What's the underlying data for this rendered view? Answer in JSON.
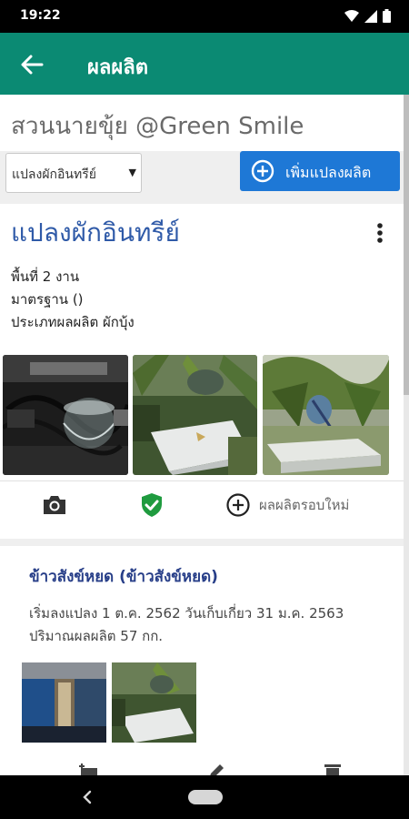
{
  "status_bar": {
    "time": "19:22",
    "icons": [
      "wifi-icon",
      "signal-icon",
      "battery-icon"
    ]
  },
  "app_bar": {
    "title": "ผลผลิต",
    "back_icon": "arrow-left-icon",
    "color": "#0b8a73"
  },
  "farm": {
    "name": "สวนนายขุ้ย @Green Smile"
  },
  "plot_selector": {
    "selected": "แปลงผักอินทรีย์",
    "caret": "▼"
  },
  "add_plot_button": {
    "label": "เพิ่มแปลงผลิต",
    "icon": "plus-circle-icon",
    "color": "#1e78d6"
  },
  "plot": {
    "title": "แปลงผักอินทรีย์",
    "area": "พื้นที่ 2 งาน",
    "standard": "มาตรฐาน ()",
    "product_type": "ประเภทผลผลิต ผักบุ้ง",
    "photos": [
      "photo-cables",
      "photo-garden-bowl",
      "photo-garden-plants"
    ],
    "actions": {
      "new_round_label": "ผลผลิตรอบใหม่"
    }
  },
  "product": {
    "title": "ข้าวสังข์หยด (ข้าวสังข์หยด)",
    "description": "เริ่มลงแปลง 1 ต.ค. 2562 วันเก็บเกี่ยว 31 ม.ค. 2563 ปริมาณผลผลิต 57 กก.",
    "photos": [
      "photo-room",
      "photo-garden"
    ]
  }
}
